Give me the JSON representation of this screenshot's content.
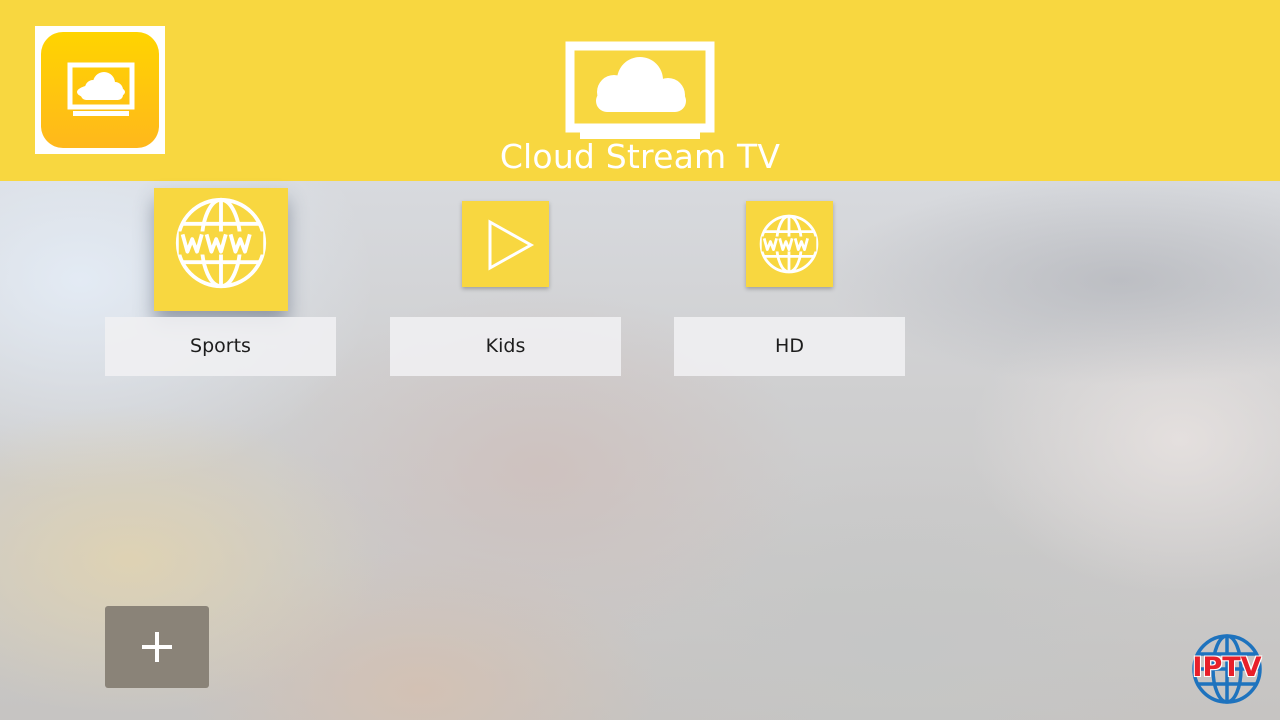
{
  "header": {
    "app_icon": "cloud-tv-app-icon",
    "logo_icon": "cloud-tv-icon",
    "title": "Cloud Stream TV",
    "background_color": "#f8d740"
  },
  "categories": [
    {
      "label": "Sports",
      "icon": "www-globe-icon",
      "focused": true
    },
    {
      "label": "Kids",
      "icon": "play-icon",
      "focused": false
    },
    {
      "label": "HD",
      "icon": "www-globe-icon",
      "focused": false
    }
  ],
  "add_button": {
    "icon": "plus-icon",
    "label": "+"
  },
  "badge": {
    "text": "IPTV",
    "icon": "globe-icon",
    "text_color": "#e8202a",
    "globe_color": "#1e73be"
  }
}
